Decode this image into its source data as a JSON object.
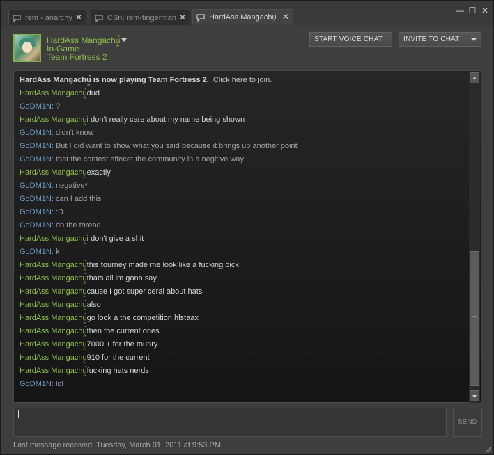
{
  "tabs": [
    {
      "label": "rem - anarchy",
      "close": "✕",
      "icon": "chat-bubble-icon"
    },
    {
      "label": "CSn| rem-fingerman",
      "close": "✕",
      "icon": "chat-bubble-icon"
    },
    {
      "label": "HardAss Mangachụ͖̀",
      "close": "✕",
      "icon": "chat-bubble-icon"
    }
  ],
  "window_controls": {
    "minimize": "—",
    "maximize": "☐",
    "close": "✕"
  },
  "header": {
    "name": "HardAss Mangachụ͖̀",
    "status": "In-Game",
    "game": "Team Fortress 2",
    "voice_button": "START VOICE CHAT",
    "invite_button": "INVITE TO CHAT"
  },
  "system_message": {
    "text": "HardAss Mangachụ͖̀ is now playing Team Fortress 2.",
    "link": "Click here to join."
  },
  "messages": [
    {
      "speaker": "HardAss Mangachụ͖̀",
      "sep": "",
      "text": "dud",
      "who": "g"
    },
    {
      "speaker": "GoDM1N",
      "sep": ": ",
      "text": "?",
      "who": "b"
    },
    {
      "speaker": "HardAss Mangachụ͖̀",
      "sep": "",
      "text": "i don't really care about my name being shown",
      "who": "g"
    },
    {
      "speaker": "GoDM1N",
      "sep": ": ",
      "text": "didn't know",
      "who": "b"
    },
    {
      "speaker": "GoDM1N",
      "sep": ": ",
      "text": "But I did want to show what you said because it brings up another point",
      "who": "b"
    },
    {
      "speaker": "GoDM1N",
      "sep": ": ",
      "text": "that the contest effecet the community in a negitive way",
      "who": "b"
    },
    {
      "speaker": "HardAss Mangachụ͖̀",
      "sep": "",
      "text": "exactly",
      "who": "g"
    },
    {
      "speaker": "GoDM1N",
      "sep": ": ",
      "text": "negative*",
      "who": "b"
    },
    {
      "speaker": "GoDM1N",
      "sep": ": ",
      "text": "can I add this",
      "who": "b"
    },
    {
      "speaker": "GoDM1N",
      "sep": ": ",
      "text": ":D",
      "who": "b"
    },
    {
      "speaker": "GoDM1N",
      "sep": ": ",
      "text": "do the thread",
      "who": "b"
    },
    {
      "speaker": "HardAss Mangachụ͖̀",
      "sep": "",
      "text": "i don't give a shit",
      "who": "g"
    },
    {
      "speaker": "GoDM1N",
      "sep": ": ",
      "text": "k",
      "who": "b"
    },
    {
      "speaker": "HardAss Mangachụ͖̀",
      "sep": "",
      "text": "this tourney made me look like a fucking dick",
      "who": "g"
    },
    {
      "speaker": "HardAss Mangachụ͖̀",
      "sep": "",
      "text": "thats all im gona say",
      "who": "g"
    },
    {
      "speaker": "HardAss Mangachụ͖̀",
      "sep": "",
      "text": "cause I got super ceral about hats",
      "who": "g"
    },
    {
      "speaker": "HardAss Mangachụ͖̀",
      "sep": "",
      "text": "also",
      "who": "g"
    },
    {
      "speaker": "HardAss Mangachụ͖̀",
      "sep": "",
      "text": "go look a the competition hlstaax",
      "who": "g"
    },
    {
      "speaker": "HardAss Mangachụ͖̀",
      "sep": "",
      "text": "then the current ones",
      "who": "g"
    },
    {
      "speaker": "HardAss Mangachụ͖̀",
      "sep": "",
      "text": "7000 + for the tounry",
      "who": "g"
    },
    {
      "speaker": "HardAss Mangachụ͖̀",
      "sep": "",
      "text": "910 for the current",
      "who": "g"
    },
    {
      "speaker": "HardAss Mangachụ͖̀",
      "sep": "",
      "text": "fucking hats nerds",
      "who": "g"
    },
    {
      "speaker": "GoDM1N",
      "sep": ": ",
      "text": "lol",
      "who": "b"
    }
  ],
  "input": {
    "value": ""
  },
  "send_label": "SEND",
  "footer": "Last message received: Tuesday, March 01, 2011 at 9:53 PM",
  "colors": {
    "speaker_self": "#8fbd4d",
    "speaker_other": "#6d9fc7",
    "background": "#3e3e3d"
  }
}
